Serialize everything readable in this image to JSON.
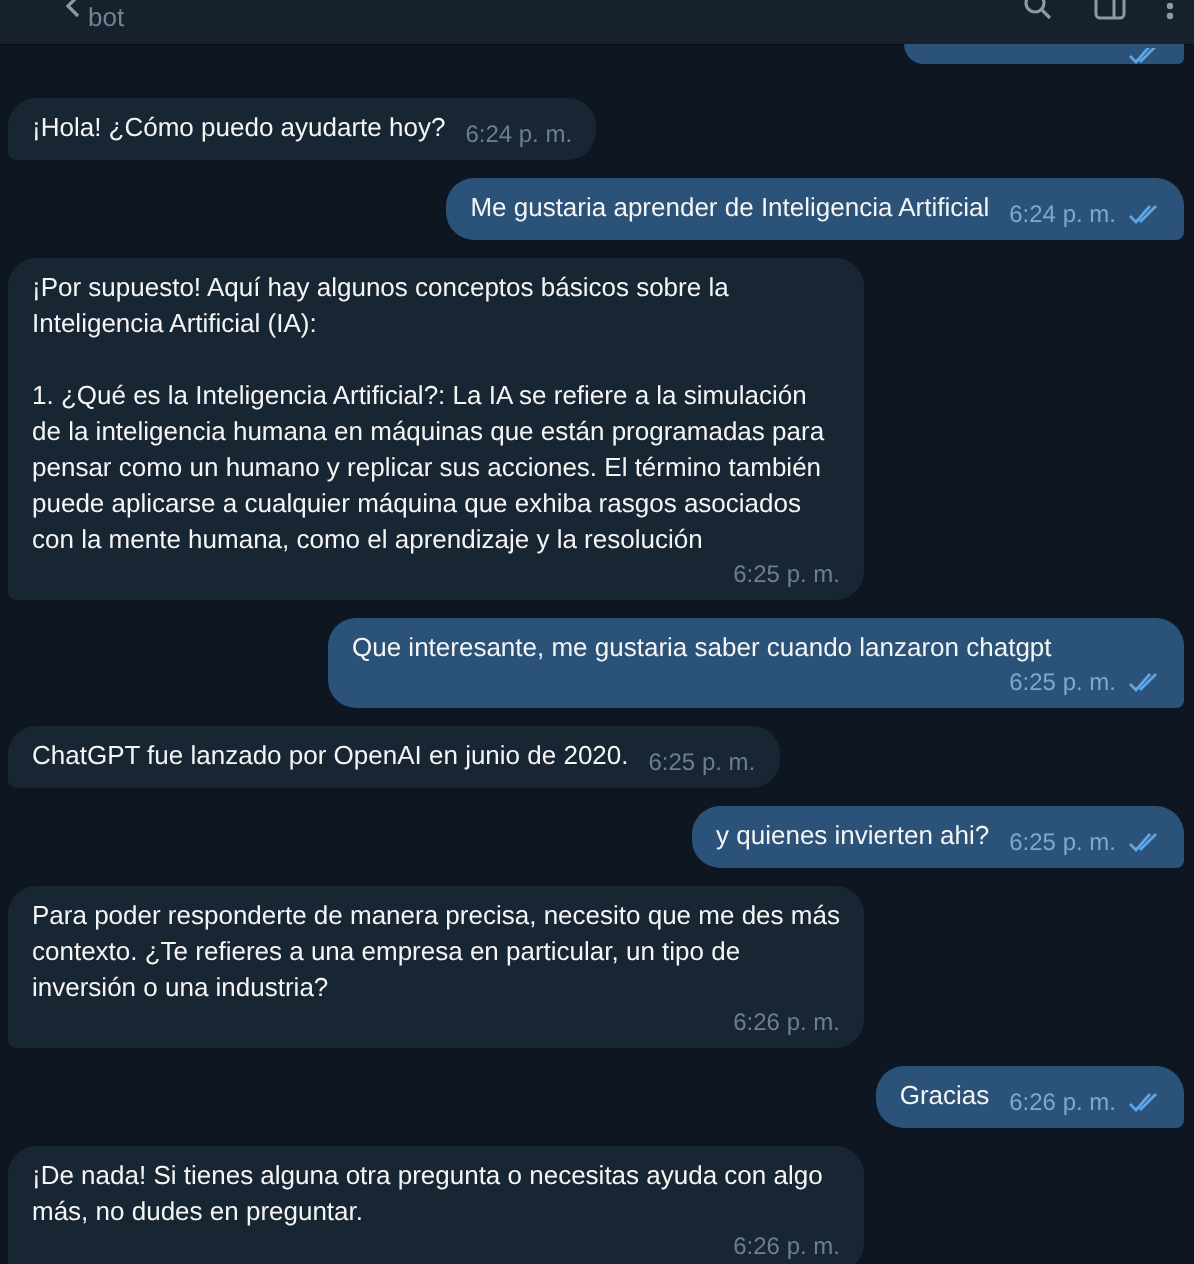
{
  "header": {
    "subtitle": "bot"
  },
  "messages": [
    {
      "outgoing": true,
      "read": true,
      "kind": "partial"
    },
    {
      "outgoing": false,
      "text": "¡Hola! ¿Cómo puedo ayudarte hoy?",
      "time": "6:24 p. m.",
      "kind": "message"
    },
    {
      "outgoing": true,
      "text": "Me gustaria aprender de Inteligencia Artificial",
      "time": "6:24 p. m.",
      "read": true,
      "kind": "message"
    },
    {
      "outgoing": false,
      "text": "¡Por supuesto! Aquí hay algunos conceptos básicos sobre la Inteligencia Artificial (IA):\n\n1. ¿Qué es la Inteligencia Artificial?: La IA se refiere a la simulación de la inteligencia humana en máquinas que están programadas para pensar como un humano y replicar sus acciones. El término también puede aplicarse a cualquier máquina que exhiba rasgos asociados con la mente humana, como el aprendizaje y la resolución",
      "time": "6:25 p. m.",
      "kind": "message"
    },
    {
      "outgoing": true,
      "text": "Que interesante, me gustaria saber cuando lanzaron chatgpt",
      "time": "6:25 p. m.",
      "read": true,
      "kind": "message"
    },
    {
      "outgoing": false,
      "text": "ChatGPT fue lanzado por OpenAI en junio de 2020.",
      "time": "6:25 p. m.",
      "kind": "message"
    },
    {
      "outgoing": true,
      "text": "y quienes invierten ahi?",
      "time": "6:25 p. m.",
      "read": true,
      "kind": "message"
    },
    {
      "outgoing": false,
      "text": "Para poder responderte de manera precisa, necesito que me des más contexto. ¿Te refieres a una empresa en particular, un tipo de inversión o una industria?",
      "time": "6:26 p. m.",
      "kind": "message"
    },
    {
      "outgoing": true,
      "text": "Gracias",
      "time": "6:26 p. m.",
      "read": true,
      "kind": "message"
    },
    {
      "outgoing": false,
      "text": "¡De nada! Si tienes alguna otra pregunta o necesitas ayuda con algo más, no dudes en preguntar.",
      "time": "6:26 p. m.",
      "kind": "message"
    }
  ]
}
